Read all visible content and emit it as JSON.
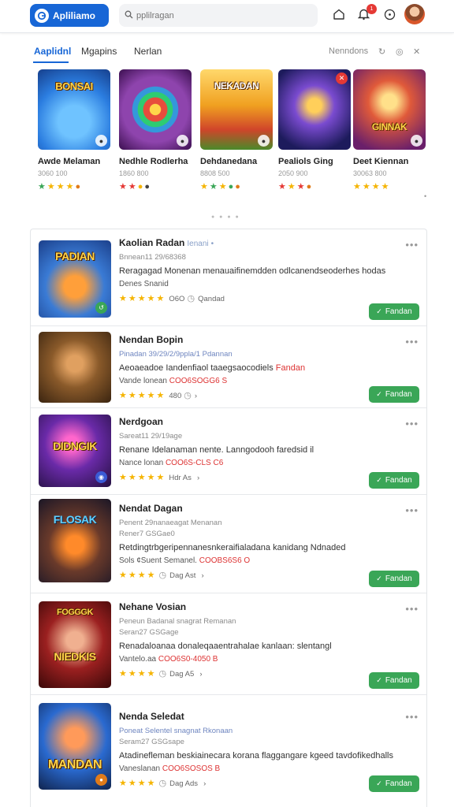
{
  "header": {
    "brand_label": "Apliliamo",
    "search_placeholder": "pplilragan",
    "notification_count": "1"
  },
  "tabs": {
    "items": [
      "Aaplidnl",
      "Mgapins",
      "Nerlan"
    ],
    "active_index": 0,
    "right_label": "Nenndons"
  },
  "featured": [
    {
      "title": "Awde Melaman",
      "sub": "3060 100",
      "art": "BONSAI",
      "bg": "#2b7de0"
    },
    {
      "title": "Nedhle Rodlerha",
      "sub": "1860 800",
      "art": "",
      "bg": "#6a2a8c"
    },
    {
      "title": "Dehdanedana",
      "sub": "8808 500",
      "art": "NEKADAN",
      "bg": "#f0a020"
    },
    {
      "title": "Pealiols Ging",
      "sub": "2050 900",
      "art": "",
      "bg": "#2a2f8a"
    },
    {
      "title": "Deet Kiennan",
      "sub": "30063 800",
      "art": "GINNAK",
      "bg": "#e05a3a"
    }
  ],
  "list": [
    {
      "title": "Kaolian Radan",
      "title_suffix": "Ienani",
      "meta": "Bnnean11 29/68368",
      "desc": "Reragagad Monenan menauaifinemdden odlcanendseoderhes hodas",
      "desc_hl": "",
      "sub": "Denes Snanid",
      "sub_hl": "",
      "rating_text": "O6O",
      "rating_extra": "Qandad",
      "art": "PADIAN",
      "bg": "#3a7bd5",
      "install": "Fandan"
    },
    {
      "title": "Nendan Bopin",
      "title_suffix": "",
      "meta": "Pinadan 39/29/2/9ppla/1 Pdannan",
      "desc": "Aeoaeadoe Iandenfiaol taaegsaocodiels",
      "desc_hl": "Fandan",
      "sub": "Vande lonean",
      "sub_hl": "COO6SOGG6 S",
      "rating_text": "480",
      "rating_extra": "",
      "art": "",
      "bg": "#8a5a2a",
      "install": "Fandan"
    },
    {
      "title": "Nerdgoan",
      "title_suffix": "",
      "meta": "Sareat11 29/19age",
      "desc": "Renane Idelanaman nente. Lanngodooh faredsid il",
      "desc_hl": "",
      "sub": "Nance lonan",
      "sub_hl": "COO6S-CLS C6",
      "rating_text": "Hdr As",
      "rating_extra": "",
      "art": "DIDNGIK",
      "bg": "#6a2aa8",
      "install": "Fandan"
    },
    {
      "title": "Nendat Dagan",
      "title_suffix": "",
      "meta": "Penent 29nanaeagat Menanan",
      "meta2": "Rener7 GSGae0",
      "desc": "Retdingtrbgeripennanesnkeraifialadana kanidang Ndnaded",
      "desc_hl": "",
      "sub": "Sols ¢Suent Semanel.",
      "sub_hl": "COOBS6S6 O",
      "rating_text": "Dag Ast",
      "rating_extra": "",
      "art": "FLOSAK",
      "bg": "#2b2540",
      "install": "Fandan"
    },
    {
      "title": "Nehane Vosian",
      "title_suffix": "",
      "meta": "Peneun Badanal snagrat Remanan",
      "meta2": "Seran27 GSGage",
      "desc": "Renadaloanaa donaleqaaentrahalae kanlaan: slentangl",
      "desc_hl": "",
      "sub": "Vantelo.aa",
      "sub_hl": "COO6S0-4050 B",
      "rating_text": "Dag A5",
      "rating_extra": "",
      "art": "NIEDKIS",
      "bg": "#9b2020",
      "install": "Fandan"
    },
    {
      "title": "Nenda Seledat",
      "title_suffix": "",
      "meta": "Poneat Selentel snagnat Rkonaan",
      "meta2": "Seram27 GSGsape",
      "desc": "Atadinefleman beskiainecara korana flaggangare kgeed tavdofikedhalls",
      "desc_hl": "",
      "sub": "Vaneslanan",
      "sub_hl": "COO6SOSOS B",
      "rating_text": "Dag Ads",
      "rating_extra": "",
      "art": "MANDAN",
      "bg": "#2a6ad0",
      "install": "Fandan"
    }
  ]
}
